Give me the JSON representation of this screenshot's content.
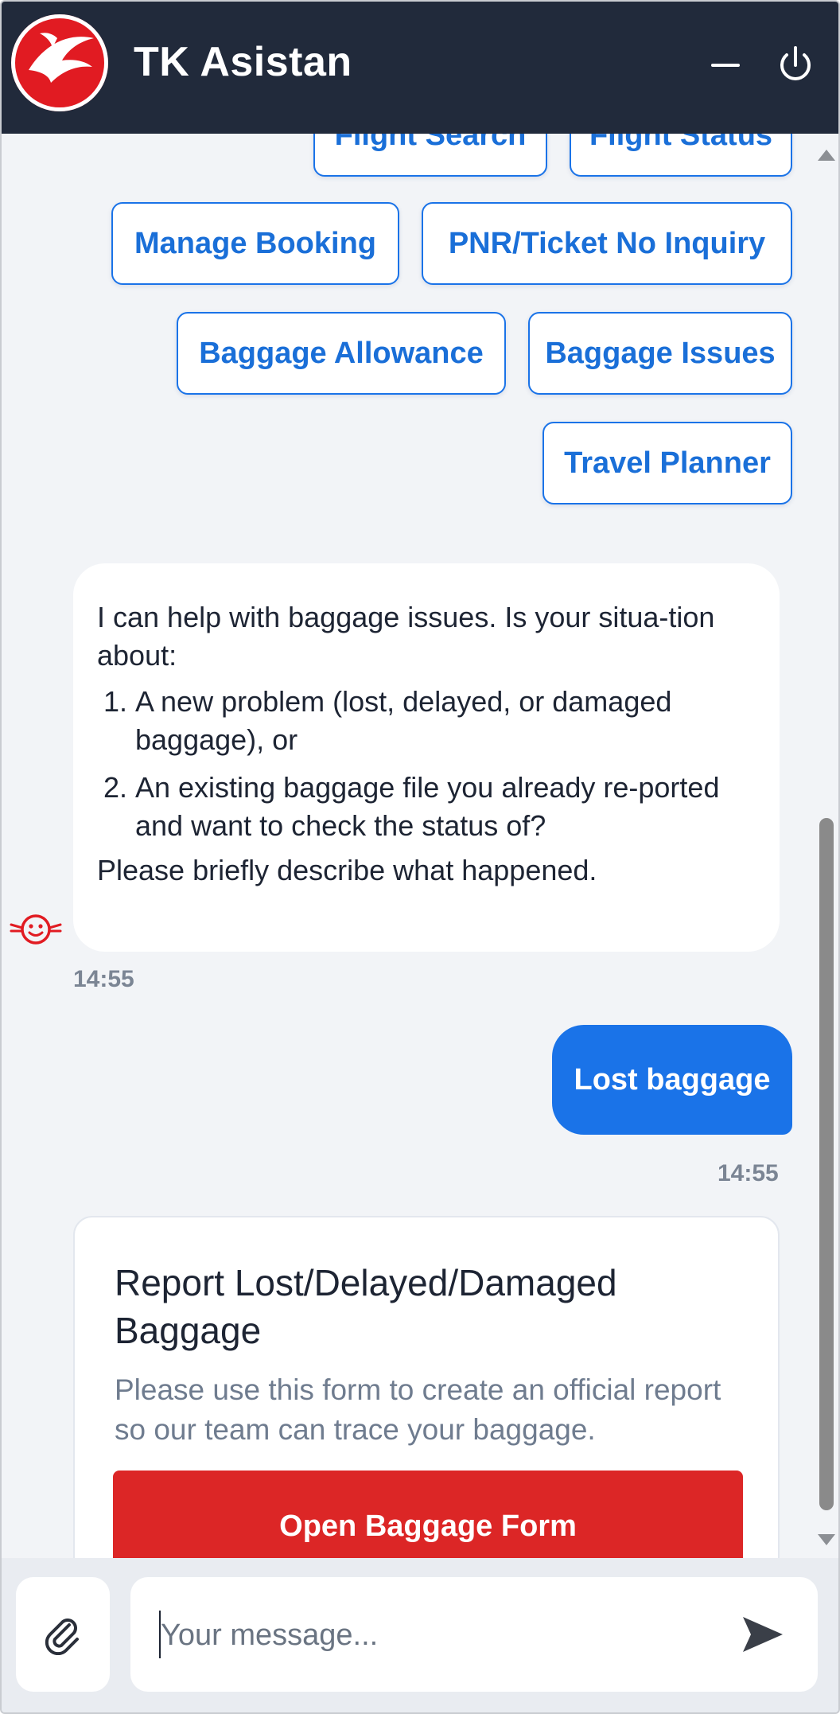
{
  "header": {
    "title": "TK Asistan",
    "minimize_icon": "minus-icon",
    "power_icon": "power-icon"
  },
  "quick_replies": [
    {
      "label": "Flight Search"
    },
    {
      "label": "Flight Status"
    },
    {
      "label": "Manage Booking"
    },
    {
      "label": "PNR/Ticket No Inquiry"
    },
    {
      "label": "Baggage Allowance"
    },
    {
      "label": "Baggage Issues"
    },
    {
      "label": "Travel Planner"
    }
  ],
  "bot_message": {
    "intro": "I can help with baggage issues. Is your situa-tion about:",
    "options": [
      "A new problem (lost, delayed, or damaged baggage), or",
      "An existing baggage file you already re-ported and want to check the status of?"
    ],
    "closing": "Please briefly describe what happened.",
    "time": "14:55"
  },
  "user_message": {
    "text": "Lost baggage",
    "time": "14:55"
  },
  "baggage_card": {
    "title": "Report Lost/Delayed/Damaged Baggage",
    "description": "Please use this form to create an official report so our team can trace your baggage.",
    "button_label": "Open Baggage Form"
  },
  "composer": {
    "placeholder": "Your message...",
    "attach_icon": "paperclip-icon",
    "send_icon": "send-icon"
  },
  "colors": {
    "header_bg": "#212a3b",
    "brand_red": "#e11b22",
    "accent_blue": "#1a73e8",
    "form_button": "#dc2626",
    "chat_bg": "#f2f4f7"
  }
}
